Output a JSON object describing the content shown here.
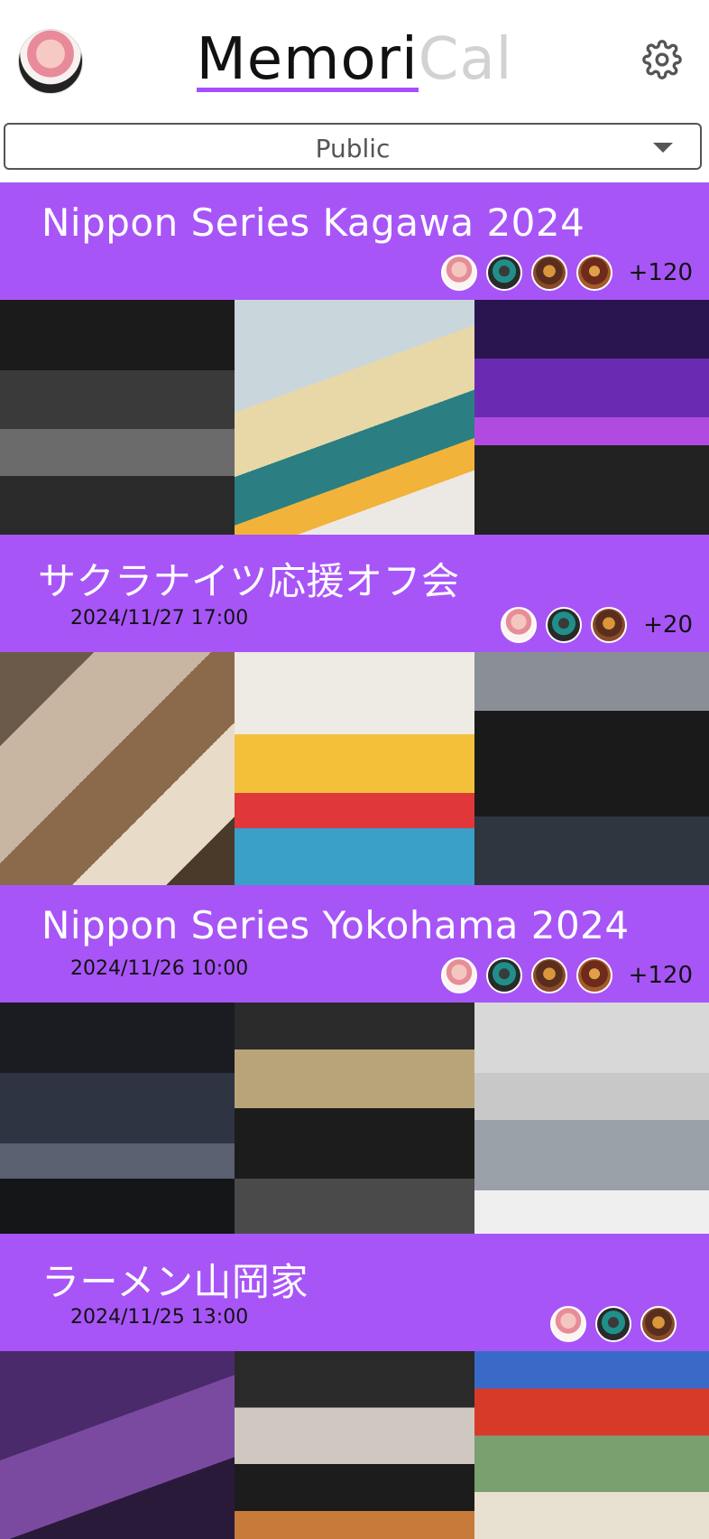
{
  "header": {
    "logo_part1": "Memori",
    "logo_part2": "Cal"
  },
  "visibility": {
    "selected": "Public"
  },
  "events": [
    {
      "title": "Nippon Series Kagawa 2024",
      "date": "",
      "more": "+120"
    },
    {
      "title": "サクラナイツ応援オフ会",
      "date": "2024/11/27 17:00",
      "more": "+20"
    },
    {
      "title": "Nippon Series Yokohama 2024",
      "date": "2024/11/26 10:00",
      "more": "+120"
    },
    {
      "title": "ラーメン山岡家",
      "date": "2024/11/25 13:00",
      "more": ""
    }
  ],
  "colors": {
    "accent": "#a855f7",
    "logo_underline": "#a64dff"
  },
  "icons": {
    "settings": "gear-icon",
    "dropdown": "chevron-down-icon"
  }
}
